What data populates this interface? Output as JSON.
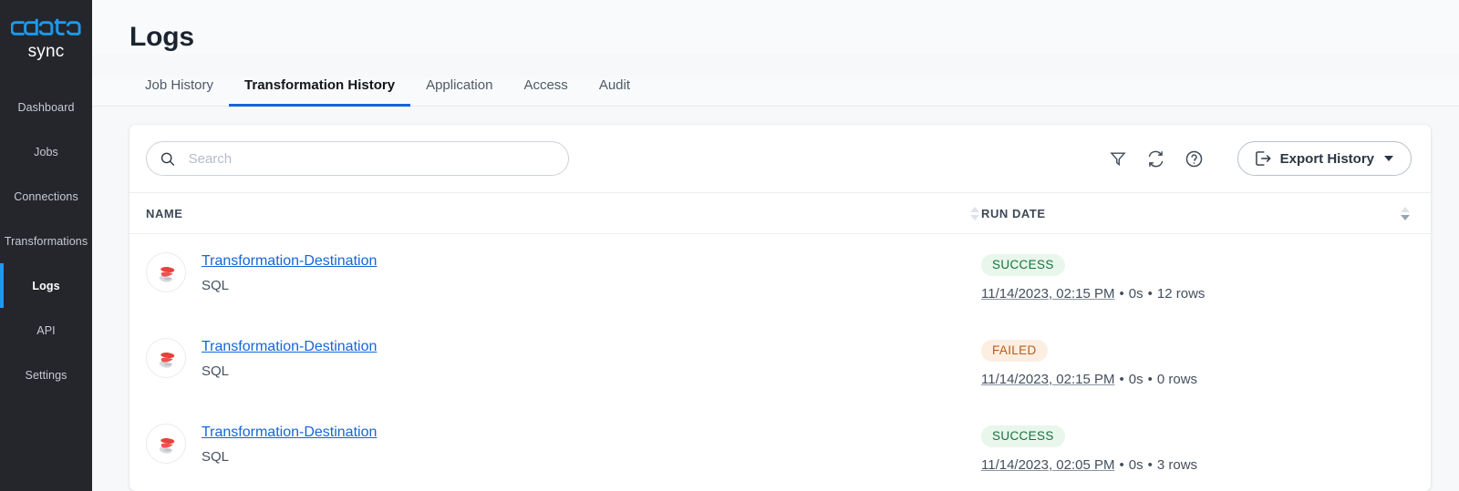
{
  "brand": {
    "name": "cdata",
    "product": "sync"
  },
  "sidebar": {
    "items": [
      {
        "label": "Dashboard",
        "active": false
      },
      {
        "label": "Jobs",
        "active": false
      },
      {
        "label": "Connections",
        "active": false
      },
      {
        "label": "Transformations",
        "active": false
      },
      {
        "label": "Logs",
        "active": true
      },
      {
        "label": "API",
        "active": false
      },
      {
        "label": "Settings",
        "active": false
      }
    ],
    "accent_color": "#1a9bf0"
  },
  "header": {
    "title": "Logs"
  },
  "tabs": [
    {
      "label": "Job History",
      "active": false
    },
    {
      "label": "Transformation History",
      "active": true
    },
    {
      "label": "Application",
      "active": false
    },
    {
      "label": "Access",
      "active": false
    },
    {
      "label": "Audit",
      "active": false
    }
  ],
  "toolbar": {
    "search_placeholder": "Search",
    "search_value": "",
    "filter_icon": "filter-icon",
    "refresh_icon": "refresh-icon",
    "help_icon": "help-icon",
    "export_label": "Export History"
  },
  "table": {
    "columns": [
      {
        "label": "NAME",
        "sort": "none"
      },
      {
        "label": "RUN DATE",
        "sort": "desc"
      }
    ],
    "rows": [
      {
        "icon": "sql-server-icon",
        "name": "Transformation-Destination",
        "type": "SQL",
        "status": "SUCCESS",
        "status_kind": "success",
        "run_date": "11/14/2023, 02:15 PM",
        "duration": "0s",
        "rows": "12 rows"
      },
      {
        "icon": "sql-server-icon",
        "name": "Transformation-Destination",
        "type": "SQL",
        "status": "FAILED",
        "status_kind": "failed",
        "run_date": "11/14/2023, 02:15 PM",
        "duration": "0s",
        "rows": "0 rows"
      },
      {
        "icon": "sql-server-icon",
        "name": "Transformation-Destination",
        "type": "SQL",
        "status": "SUCCESS",
        "status_kind": "success",
        "run_date": "11/14/2023, 02:05 PM",
        "duration": "0s",
        "rows": "3 rows"
      }
    ],
    "separator": "•"
  },
  "colors": {
    "sidebar_bg": "#24262b",
    "accent_blue": "#1565d8",
    "success_text": "#14743b",
    "success_bg": "#e8f6ec",
    "failed_text": "#b95c17",
    "failed_bg": "#fdeee2",
    "link": "#1565d8"
  }
}
